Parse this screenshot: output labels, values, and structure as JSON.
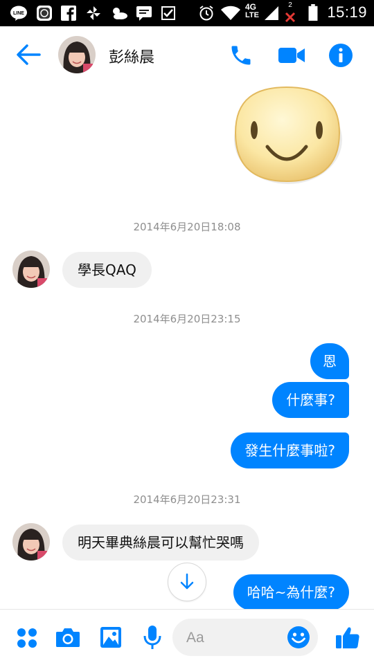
{
  "status_bar": {
    "time": "15:19",
    "network": "4G",
    "network_sub": "LTE",
    "sim_badge": "2"
  },
  "conversation": {
    "contact_name": "彭絲晨"
  },
  "messages": [
    {
      "type": "sticker",
      "direction": "outgoing",
      "sticker": "smiley-face-sticker"
    },
    {
      "type": "timestamp",
      "text": "2014年6月20日18:08"
    },
    {
      "type": "text",
      "direction": "incoming",
      "text": "學長QAQ"
    },
    {
      "type": "timestamp",
      "text": "2014年6月20日23:15"
    },
    {
      "type": "text",
      "direction": "outgoing",
      "text": "恩"
    },
    {
      "type": "text",
      "direction": "outgoing",
      "text": "什麼事?"
    },
    {
      "type": "text",
      "direction": "outgoing",
      "text": "發生什麼事啦?"
    },
    {
      "type": "timestamp",
      "text": "2014年6月20日23:31"
    },
    {
      "type": "text",
      "direction": "incoming",
      "text": "明天畢典絲晨可以幫忙哭嗎"
    },
    {
      "type": "text",
      "direction": "outgoing",
      "text": "哈哈~為什麼?"
    }
  ],
  "composer": {
    "placeholder": "Aa"
  },
  "colors": {
    "accent": "#0084ff",
    "incoming_bubble": "#f0f0f0",
    "timestamp": "#8e8e8e"
  }
}
